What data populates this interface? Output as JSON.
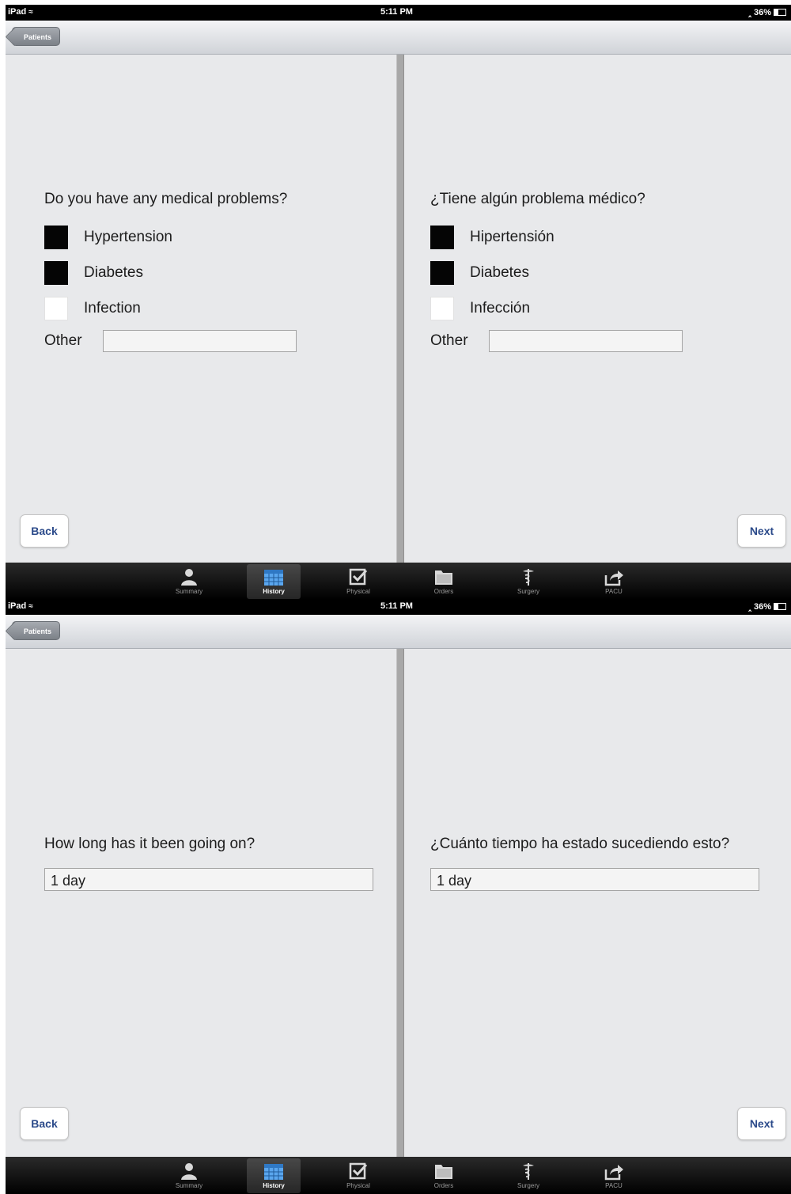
{
  "status_bar": {
    "device": "iPad",
    "time": "5:11 PM",
    "battery": "36%"
  },
  "nav_bar": {
    "back_label": "Patients"
  },
  "screen_1": {
    "left": {
      "question": "Do you have any medical problems?",
      "options": [
        {
          "label": "Hypertension",
          "checked": true
        },
        {
          "label": "Diabetes",
          "checked": true
        },
        {
          "label": "Infection",
          "checked": false
        }
      ],
      "other_label": "Other",
      "other_value": ""
    },
    "right": {
      "question": "¿Tiene algún problema médico?",
      "options": [
        {
          "label": "Hipertensión",
          "checked": true
        },
        {
          "label": "Diabetes",
          "checked": true
        },
        {
          "label": "Infección",
          "checked": false
        }
      ],
      "other_label": "Other",
      "other_value": ""
    },
    "back_label": "Back",
    "next_label": "Next"
  },
  "screen_2": {
    "left": {
      "question": "How long has it been going on?",
      "answer": "1 day"
    },
    "right": {
      "question": "¿Cuánto tiempo ha estado sucediendo esto?",
      "answer": "1 day"
    },
    "back_label": "Back",
    "next_label": "Next"
  },
  "tab_bar": {
    "tabs": [
      {
        "label": "Summary",
        "icon": "person-icon"
      },
      {
        "label": "History",
        "icon": "calendar-icon",
        "selected": true
      },
      {
        "label": "Physical",
        "icon": "checkbox-icon"
      },
      {
        "label": "Orders",
        "icon": "folder-icon"
      },
      {
        "label": "Surgery",
        "icon": "caduceus-icon"
      },
      {
        "label": "PACU",
        "icon": "share-icon"
      }
    ]
  },
  "colors": {
    "background": "#e8e9eb",
    "accent_button_text": "#2b4a8a",
    "selected_tab_icon": "#6ab0f0"
  }
}
